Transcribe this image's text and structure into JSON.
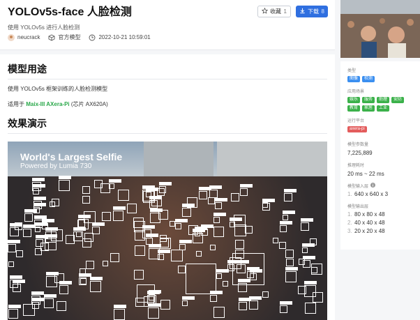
{
  "header": {
    "title": "YOLOv5s-face 人脸检测",
    "subtitle": "使用 YOLOv5s 进行人脸检测",
    "author": "neucrack",
    "category": "官方模型",
    "datetime": "2022-10-21 10:59:01",
    "fav_label": "收藏",
    "fav_count": "1",
    "download_label": "下载",
    "download_count": "8"
  },
  "content": {
    "usage_heading": "模型用途",
    "usage_text": "使用 YOLOv5s 框架训练的人脸检测模型",
    "applies_prefix": "适用于 ",
    "applies_link": "Maix-III AXera-Pi",
    "applies_suffix": " (芯片 AX620A)",
    "demo_heading": "效果演示",
    "demo_text_line1": "World's Largest Selfie",
    "demo_text_line2": "Powered by Lumia 730"
  },
  "sidebar": {
    "type_label": "类型",
    "type_tags": [
      "图像",
      "检测"
    ],
    "scene_label": "应用场景",
    "scene_tags": [
      "娱乐",
      "服务",
      "助理",
      "安防",
      "教育",
      "家居",
      "工业"
    ],
    "platform_label": "运行平台",
    "platform_tag": "axera-pi",
    "params_label": "模型参数量",
    "params_value": "7,225,889",
    "infer_label": "推理耗时",
    "infer_value": "20 ms ~ 22 ms",
    "input_label": "模型输入层",
    "input_rows": [
      {
        "n": "1.",
        "v": "640 x 640 x 3"
      }
    ],
    "output_label": "模型输出层",
    "output_rows": [
      {
        "n": "1.",
        "v": "80 x 80 x 48"
      },
      {
        "n": "2.",
        "v": "40 x 40 x 48"
      },
      {
        "n": "3.",
        "v": "20 x 20 x 48"
      }
    ]
  },
  "colors": {
    "accent": "#2f6fe0",
    "tag_blue": "#3b8ff0",
    "tag_green": "#3bb14a",
    "tag_red": "#e35c5c",
    "link_green": "#2aa84a"
  }
}
